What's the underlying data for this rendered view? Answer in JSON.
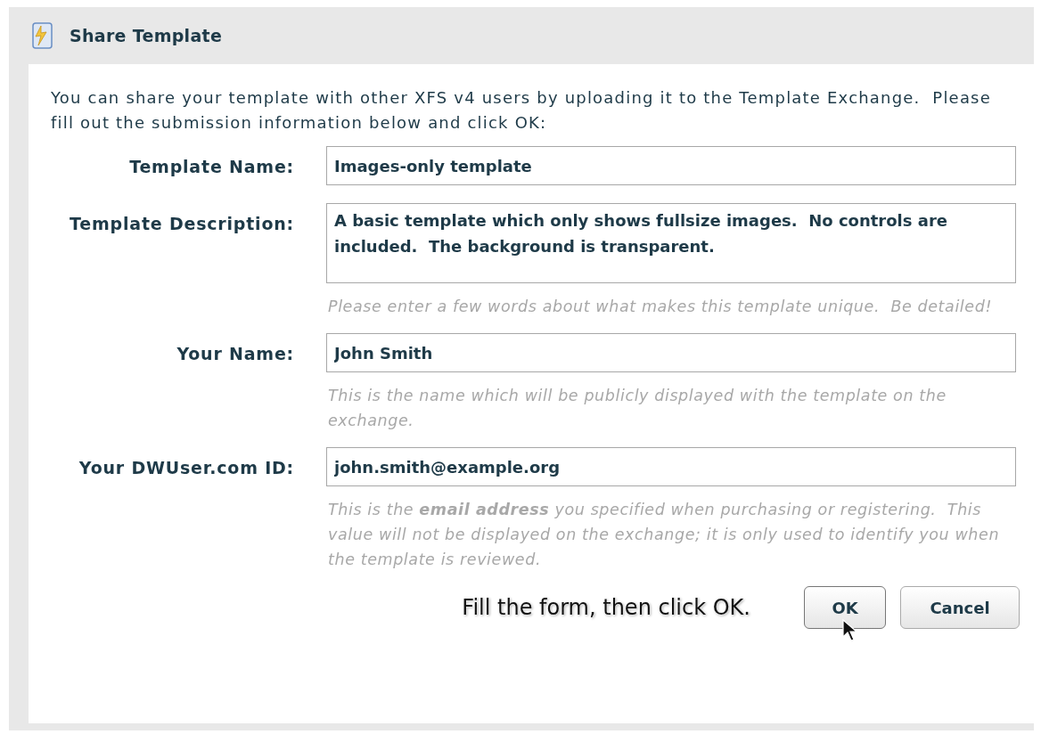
{
  "window": {
    "title": "Share Template"
  },
  "intro": "You can share your template with other XFS v4 users by uploading it to the Template Exchange.  Please fill out the submission information below and click OK:",
  "fields": [
    {
      "kind": "line",
      "label": "Template Name:",
      "value": "Images-only template"
    },
    {
      "kind": "area",
      "label": "Template Description:",
      "value": "A basic template which only shows fullsize images.  No controls are included.  The background is transparent.",
      "hint": "Please enter a few words about what makes this template unique.  Be detailed!"
    },
    {
      "kind": "line",
      "label": "Your Name:",
      "value": "John Smith",
      "hint": "This is the name which will be publicly displayed with the template on the exchange."
    },
    {
      "kind": "line",
      "label": "Your DWUser.com ID:",
      "value": "john.smith@example.org",
      "hint": "This is the **email address** you specified when purchasing or registering.  This value will not be displayed on the exchange; it is only used to identify you when the template is reviewed."
    }
  ],
  "caption": "Fill the form, then click OK.",
  "buttons": [
    {
      "label": "OK",
      "kind": "primary"
    },
    {
      "label": "Cancel",
      "kind": "secondary"
    }
  ]
}
